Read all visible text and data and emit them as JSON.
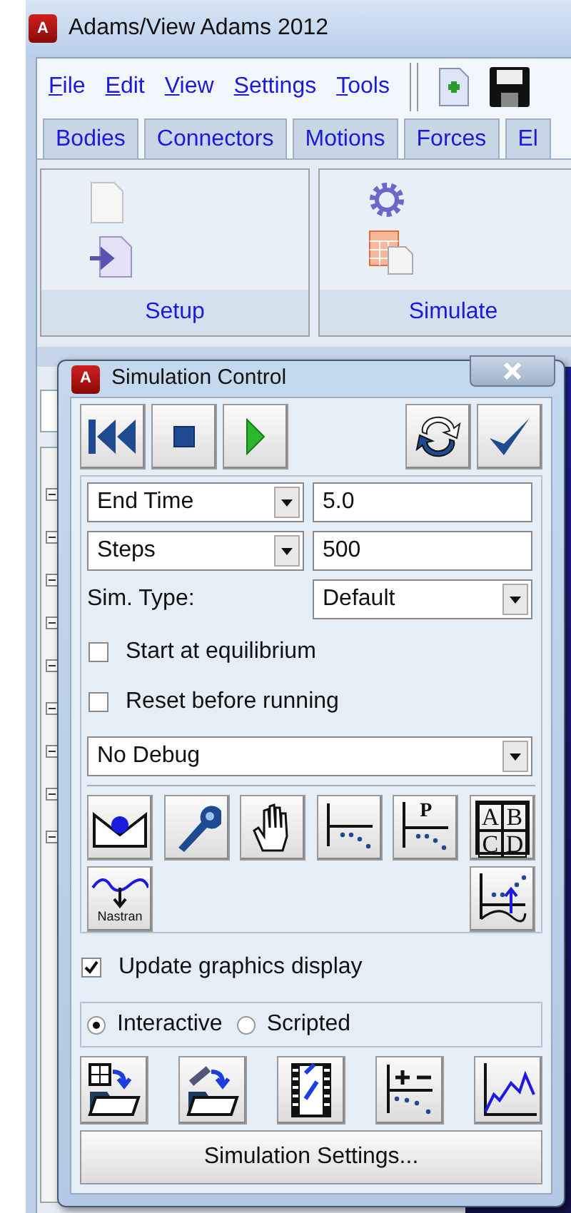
{
  "window": {
    "title": "Adams/View Adams 2012",
    "icon_letter": "A"
  },
  "menu": [
    "File",
    "Edit",
    "View",
    "Settings",
    "Tools"
  ],
  "tabs": [
    {
      "label": "Bodies",
      "selected": false
    },
    {
      "label": "Connectors",
      "selected": false
    },
    {
      "label": "Motions",
      "selected": false
    },
    {
      "label": "Forces",
      "selected": false
    },
    {
      "label": "El",
      "selected": false
    }
  ],
  "ribbon_groups": [
    "Setup",
    "Simulate"
  ],
  "dialog": {
    "title": "Simulation Control",
    "icon_letter": "A",
    "end_spec": {
      "selection": "End Time",
      "value": "5.0"
    },
    "step_spec": {
      "selection": "Steps",
      "value": "500"
    },
    "sim_type": {
      "label": "Sim. Type:",
      "value": "Default"
    },
    "options": [
      {
        "label": "Start at equilibrium",
        "checked": false
      },
      {
        "label": "Reset before running",
        "checked": false
      }
    ],
    "debug": "No Debug",
    "plot_letter": "P",
    "table_letters": [
      "A",
      "B",
      "C",
      "D"
    ],
    "nastran_label": "Nastran",
    "update_graphics": {
      "label": "Update graphics display",
      "checked": true
    },
    "modes": [
      {
        "label": "Interactive",
        "selected": true
      },
      {
        "label": "Scripted",
        "selected": false
      }
    ],
    "settings_button": "Simulation Settings..."
  }
}
